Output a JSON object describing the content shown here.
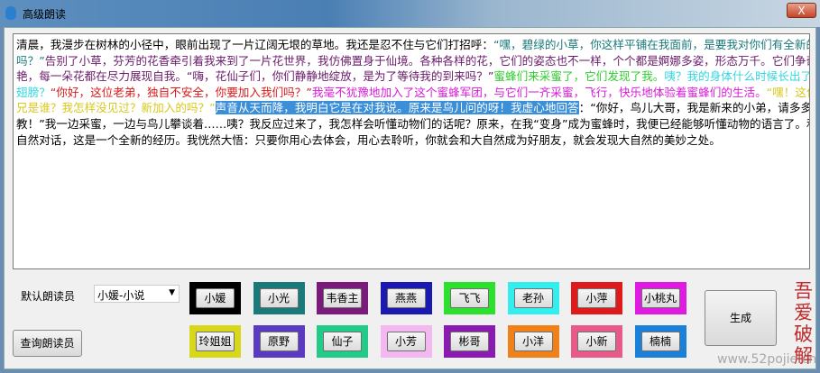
{
  "window": {
    "title": "高级朗读",
    "close_label": "X"
  },
  "text_lines": [
    [
      {
        "t": "清晨，我漫步在树林的小径中，眼前出现了一片辽阔无垠的草地。我还是忍不住与它们打招呼：",
        "c": "#000000"
      },
      {
        "t": "“嘿，碧绿的小草，你这样平铺在我面前，是要我对你们有全新的看法",
        "c": "#1a7a7a"
      }
    ],
    [
      {
        "t": "吗？”",
        "c": "#1a7a7a"
      },
      {
        "t": "告别了小草，芬芳的花香牵引着我来到了一片花世界，我仿佛置身于仙境。各种各样的花，它们的姿态也不一样，个个都是婀娜多姿，形态万千。它们争奇斗",
        "c": "#6a1a6a"
      }
    ],
    [
      {
        "t": "艳，每一朵花都在尽力展现自我。“嗨，花仙子们，你们静静地绽放，是为了等待我的到来吗？”",
        "c": "#6a1a6a"
      },
      {
        "t": "蜜蜂们来采蜜了，它们发现了我。",
        "c": "#2ecc2e"
      },
      {
        "t": "咦？我的身体什么时候长出了刺和",
        "c": "#33d6e0"
      }
    ],
    [
      {
        "t": "翅膀？",
        "c": "#33d6e0"
      },
      {
        "t": "“你好，这位老弟，独自不安全，你要加入我们吗？”",
        "c": "#d81a1a"
      },
      {
        "t": "我毫不犹豫地加入了这个蜜蜂军团，与它们一齐采蜜，飞行，快乐地体验着蜜蜂们的生活。",
        "c": "#d81ad8"
      },
      {
        "t": "“嘿！这位仁",
        "c": "#d8c81a"
      }
    ],
    [
      {
        "t": "兄是谁？我怎样没见过？新加入的吗？”",
        "c": "#d8c81a"
      },
      {
        "t": "声音从天而降，我明白它是在对我说。原来是鸟儿问的呀！我虚心地回答",
        "c": "sel"
      },
      {
        "t": "：“你好，鸟儿大哥，我是新来的小弟，请多多指",
        "c": "#000000"
      }
    ],
    [
      {
        "t": "教！”我一边采蜜，一边与鸟儿攀谈着……咦？我反应过来了，我怎样会听懂动物们的话呢？原来，在我“变身”成为蜜蜂时，我便已经能够听懂动物的语言了。和大",
        "c": "#000000"
      }
    ],
    [
      {
        "t": "自然对话，这是一个全新的经历。我恍然大悟：只要你用心去体会，用心去聆听，你就会和大自然成为好朋友，就会发现大自然的美妙之处。",
        "c": "#000000"
      }
    ]
  ],
  "controls": {
    "default_reader_label": "默认朗读员",
    "default_reader_value": "小媛-小说",
    "query_button": "查询朗读员",
    "generate_button": "生成"
  },
  "readers_row1": [
    {
      "name": "小媛",
      "color": "#000000"
    },
    {
      "name": "小光",
      "color": "#1a7a7a"
    },
    {
      "name": "韦香主",
      "color": "#7a1a7a"
    },
    {
      "name": "燕燕",
      "color": "#1a1ab0"
    },
    {
      "name": "飞飞",
      "color": "#2ee02e"
    },
    {
      "name": "老孙",
      "color": "#33eeee"
    },
    {
      "name": "小萍",
      "color": "#e01a1a"
    },
    {
      "name": "小桃丸",
      "color": "#e01ae0"
    }
  ],
  "readers_row2": [
    {
      "name": "玲姐姐",
      "color": "#d8d81a"
    },
    {
      "name": "原野",
      "color": "#5a3ac0"
    },
    {
      "name": "仙子",
      "color": "#22cc88"
    },
    {
      "name": "小芳",
      "color": "#f4b8f0"
    },
    {
      "name": "彬哥",
      "color": "#8a1ab0"
    },
    {
      "name": "小洋",
      "color": "#f0801a"
    },
    {
      "name": "小新",
      "color": "#e85a88"
    },
    {
      "name": "楠楠",
      "color": "#1a80d8"
    }
  ],
  "watermark": {
    "logo": "吾爱破解",
    "url": "www.52pojie.cn"
  }
}
